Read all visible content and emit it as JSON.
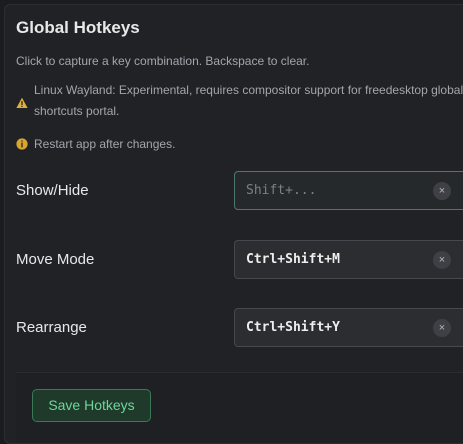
{
  "settings": {
    "title": "Global Hotkeys",
    "description": "Click to capture a key combination. Backspace to clear.",
    "wayland_notice": "Linux Wayland: Experimental, requires compositor support for freedesktop global shortcuts portal.",
    "restart_notice": "Restart app after changes.",
    "hotkeys": [
      {
        "label": "Show/Hide",
        "value": "",
        "placeholder": "Shift+...",
        "clear": "×"
      },
      {
        "label": "Move Mode",
        "value": "Ctrl+Shift+M",
        "clear": "×"
      },
      {
        "label": "Rearrange",
        "value": "Ctrl+Shift+Y",
        "clear": "×"
      }
    ],
    "save_label": "Save Hotkeys"
  },
  "icons": {
    "warning": "warning-icon",
    "info": "info-icon"
  },
  "colors": {
    "warning": "#e0b13a",
    "info": "#d9a531",
    "accent": "#6ed69a"
  }
}
